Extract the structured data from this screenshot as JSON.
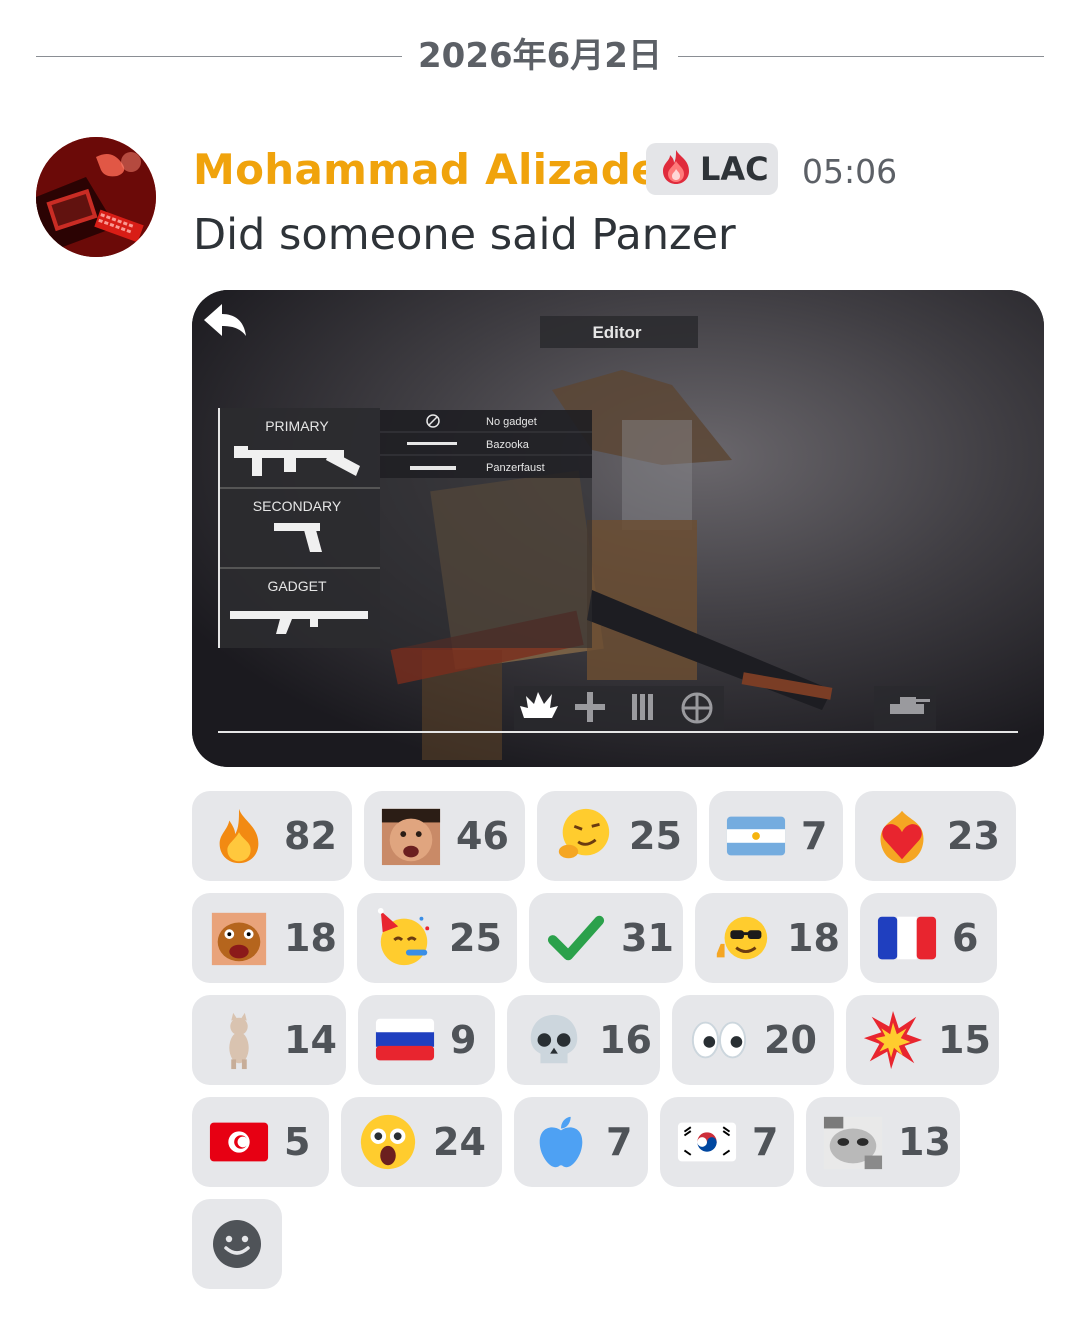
{
  "divider": {
    "date": "2026年6月2日"
  },
  "message": {
    "username": "Mohammad Alizadeh",
    "username_color": "#f0a30c",
    "tag": {
      "icon": "fire-gem-icon",
      "label": "LAC"
    },
    "timestamp": "05:06",
    "text": "Did someone said Panzer"
  },
  "attachment": {
    "editor_title": "Editor",
    "slots": [
      "PRIMARY",
      "SECONDARY",
      "GADGET"
    ],
    "options": [
      "No gadget",
      "Bazooka",
      "Panzerfaust"
    ]
  },
  "reactions": [
    {
      "icon": "fire-icon",
      "count": "82"
    },
    {
      "icon": "meme-face-icon",
      "count": "46"
    },
    {
      "icon": "smirk-emoji-icon",
      "count": "25"
    },
    {
      "icon": "argentina-flag-icon",
      "count": "7"
    },
    {
      "icon": "heart-on-fire-icon",
      "count": "23"
    },
    {
      "icon": "cartoon-dog-icon",
      "count": "18"
    },
    {
      "icon": "party-face-icon",
      "count": "25"
    },
    {
      "icon": "check-mark-icon",
      "count": "31"
    },
    {
      "icon": "sunglasses-thumbs-icon",
      "count": "18"
    },
    {
      "icon": "france-flag-icon",
      "count": "6"
    },
    {
      "icon": "dancing-cat-icon",
      "count": "14"
    },
    {
      "icon": "russia-flag-icon",
      "count": "9"
    },
    {
      "icon": "skull-icon",
      "count": "16"
    },
    {
      "icon": "eyes-icon",
      "count": "20"
    },
    {
      "icon": "collision-icon",
      "count": "15"
    },
    {
      "icon": "tunisia-flag-icon",
      "count": "5"
    },
    {
      "icon": "screaming-face-icon",
      "count": "24"
    },
    {
      "icon": "apple-icon",
      "count": "7"
    },
    {
      "icon": "south-korea-flag-icon",
      "count": "7"
    },
    {
      "icon": "cat-meme-icon",
      "count": "13"
    }
  ],
  "add_reaction": {
    "icon": "add-reaction-smile-icon"
  }
}
